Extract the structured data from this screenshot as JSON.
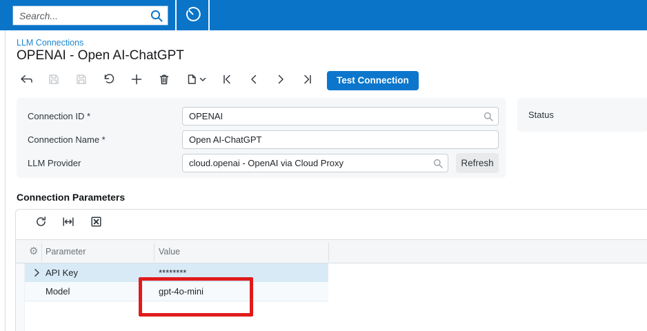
{
  "colors": {
    "topbar_blue": "#0a74c9",
    "primary_button_blue": "#0b76cb",
    "link_blue": "#1c86d1",
    "selected_row_bg": "#d9eaf7",
    "alt_row_bg": "#f6fafd",
    "panel_bg": "#f5f7f9",
    "annotation_red": "#e01b1b"
  },
  "topbar": {
    "search_placeholder": "Search...",
    "icons": [
      "search-icon",
      "business-time-clock-icon"
    ]
  },
  "page": {
    "breadcrumb": "LLM Connections",
    "title": "OPENAI - Open AI-ChatGPT"
  },
  "toolbar": {
    "icons": [
      "back",
      "save-and-close",
      "save",
      "undo",
      "add",
      "delete",
      "clipboard-menu",
      "first-record",
      "previous-record",
      "next-record",
      "last-record"
    ],
    "test_connection_label": "Test Connection"
  },
  "form": {
    "fields": [
      {
        "label": "Connection ID *",
        "value": "OPENAI",
        "lookup": true
      },
      {
        "label": "Connection Name *",
        "value": "Open AI-ChatGPT",
        "lookup": false
      },
      {
        "label": "LLM Provider",
        "value": "cloud.openai - OpenAI via Cloud Proxy",
        "lookup": true,
        "button": "Refresh"
      }
    ]
  },
  "status_panel": {
    "label": "Status"
  },
  "grid": {
    "section_title": "Connection Parameters",
    "toolbar_icons": [
      "refresh",
      "fit-to-width",
      "export-to-excel"
    ],
    "columns": [
      "Parameter",
      "Value"
    ],
    "gear_icon": "⚙",
    "rows": [
      {
        "parameter": "API Key",
        "value": "********",
        "selected": true,
        "expandable": true
      },
      {
        "parameter": "Model",
        "value": "gpt-4o-mini",
        "selected": false,
        "expandable": false
      }
    ]
  },
  "annotation": {
    "shape": "red-highlight-box",
    "target": "Model value cell (gpt-4o-mini)"
  }
}
